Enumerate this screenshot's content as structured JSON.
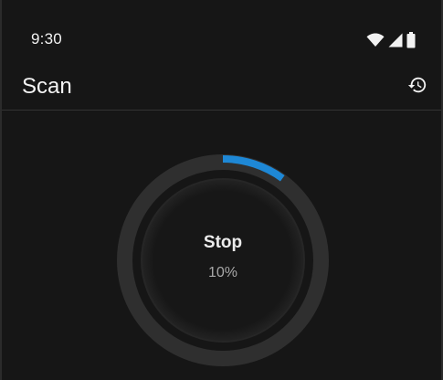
{
  "status_bar": {
    "time": "9:30",
    "icons": [
      "wifi-icon",
      "cellular-signal-icon",
      "battery-icon"
    ]
  },
  "app_bar": {
    "title": "Scan",
    "action_icon": "history-icon"
  },
  "scan": {
    "button_label": "Stop",
    "progress_text": "10%",
    "progress": 0.1
  },
  "colors": {
    "background": "#161616",
    "ring_track": "#2f2f2f",
    "progress_accent": "#1e88d6",
    "divider": "#333333"
  }
}
